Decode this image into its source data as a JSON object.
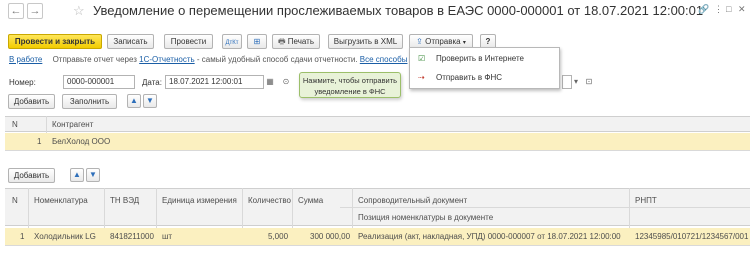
{
  "header": {
    "title": "Уведомление о перемещении прослеживаемых товаров в ЕАЭС 0000-000001 от 18.07.2021 12:00:01"
  },
  "toolbar": {
    "post_close": "Провести и закрыть",
    "save": "Записать",
    "post": "Провести",
    "print": "Печать",
    "export_xml": "Выгрузить в XML",
    "send": "Отправка",
    "help": "?"
  },
  "status_bar": {
    "state": "В работе",
    "text": "Отправьте отчет через",
    "link1": "1С-Отчетность",
    "text2": "- самый удобный способ сдачи отчетности.",
    "link2": "Все способы"
  },
  "form": {
    "number_label": "Номер:",
    "number_value": "0000-000001",
    "date_label": "Дата:",
    "date_value": "18.07.2021 12:00:01"
  },
  "send_menu": {
    "items": [
      "Проверить в Интернете",
      "Отправить в ФНС"
    ]
  },
  "tooltip": {
    "line1": "Нажмите, чтобы отправить",
    "line2": "уведомление в ФНС"
  },
  "contractors": {
    "add_button": "Добавить",
    "fill_button": "Заполнить",
    "headers": [
      "N",
      "Контрагент"
    ],
    "rows": [
      [
        "1",
        "БелХолод ООО"
      ]
    ]
  },
  "goods": {
    "add_button": "Добавить",
    "headers": [
      "N",
      "Номенклатура",
      "ТН ВЭД",
      "Единица измерения",
      "Количество",
      "Сумма",
      "Сопроводительный документ",
      "РНПТ"
    ],
    "subheader": "Позиция номенклатуры в документе",
    "rows": [
      [
        "1",
        "Холодильник LG",
        "8418211000",
        "шт",
        "5,000",
        "300 000,00",
        "Реализация (акт, накладная, УПД) 0000-000007 от 18.07.2021 12:00:00",
        "12345985/010721/1234567/001"
      ]
    ]
  }
}
